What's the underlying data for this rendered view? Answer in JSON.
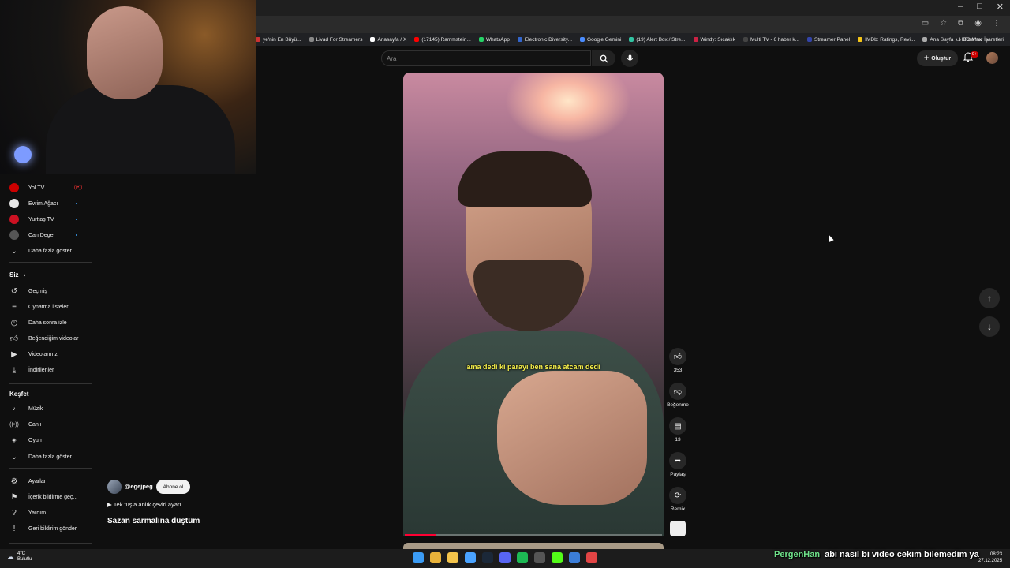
{
  "window": {
    "minimize": "–",
    "maximize": "□",
    "close": "✕"
  },
  "bookmarks": [
    {
      "label": "ye'nin En Büyü...",
      "color": "#cc3333"
    },
    {
      "label": "Livad For Streamers",
      "color": "#888888"
    },
    {
      "label": "Anasayfa / X",
      "color": "#ffffff"
    },
    {
      "label": "(17145) Rammstein...",
      "color": "#ff0000"
    },
    {
      "label": "WhatsApp",
      "color": "#25d366"
    },
    {
      "label": "Electronic Diversity...",
      "color": "#3366cc"
    },
    {
      "label": "Google Gemini",
      "color": "#4a8cff"
    },
    {
      "label": "(19) Alert Box / Stre...",
      "color": "#31c3a2"
    },
    {
      "label": "Windy: Sıcaklık",
      "color": "#cc2244"
    },
    {
      "label": "Multi TV - 6 haber k...",
      "color": "#444444"
    },
    {
      "label": "Streamer Panel",
      "color": "#3344aa"
    },
    {
      "label": "IMDb: Ratings, Revi...",
      "color": "#f5c518"
    },
    {
      "label": "Ana Sayfa + HBO Max",
      "color": "#aaaaaa"
    }
  ],
  "bookmarks_more": "»",
  "bookmarks_all": "Tüm Yer İşaretleri",
  "header": {
    "search_placeholder": "Ara",
    "create_label": "Oluştur",
    "notif_badge": "9+"
  },
  "sidebar": {
    "subscriptions": [
      {
        "label": "Yol TV",
        "icon_color": "#cc0000",
        "icon_text": "YOL",
        "status": "live"
      },
      {
        "label": "Evrim Ağacı",
        "icon_color": "#e8e8e8",
        "icon_text": "",
        "status": "new"
      },
      {
        "label": "Yurttaş TV",
        "icon_color": "#cc1122",
        "icon_text": "Y",
        "status": "new"
      },
      {
        "label": "Can Deger",
        "icon_color": "#555555",
        "icon_text": "",
        "status": "new"
      }
    ],
    "subs_more": "Daha fazla göster",
    "you_heading": "Siz",
    "you_items": [
      {
        "label": "Geçmiş",
        "icon": "↺"
      },
      {
        "label": "Oynatma listeleri",
        "icon": "≡"
      },
      {
        "label": "Daha sonra izle",
        "icon": "◷"
      },
      {
        "label": "Beğendiğim videolar",
        "icon": "👍"
      },
      {
        "label": "Videolarınız",
        "icon": "▶"
      },
      {
        "label": "İndirilenler",
        "icon": "⤓"
      }
    ],
    "explore_heading": "Keşfet",
    "explore_items": [
      {
        "label": "Müzik",
        "icon": "♪"
      },
      {
        "label": "Canlı",
        "icon": "((•))"
      },
      {
        "label": "Oyun",
        "icon": "🎮"
      }
    ],
    "explore_more": "Daha fazla göster",
    "settings_items": [
      {
        "label": "Ayarlar",
        "icon": "⚙"
      },
      {
        "label": "İçerik bildirme geç...",
        "icon": "⚑"
      },
      {
        "label": "Yardım",
        "icon": "?"
      },
      {
        "label": "Geri bildirim gönder",
        "icon": "!"
      }
    ]
  },
  "short": {
    "caption": "ama dedi ki parayı ben sana atcam dedi",
    "progress": 0.12,
    "channel": "@egejpeg",
    "subscribe": "Abone ol",
    "translate_line": "▶ Tek tuşla anlık çeviri ayarı",
    "title": "Sazan sarmalına düştüm",
    "actions": {
      "likes": "353",
      "dislike": "Beğenme",
      "comments": "13",
      "share": "Paylaş",
      "remix": "Remix"
    }
  },
  "nav": {
    "up": "↑",
    "down": "↓"
  },
  "taskbar": {
    "weather_temp": "4°C",
    "weather_desc": "Bulutlu",
    "apps": [
      "windows",
      "chrome",
      "explorer",
      "app4",
      "steam",
      "discord",
      "spotify",
      "calculator",
      "kick",
      "app10",
      "app11"
    ],
    "app_colors": [
      "#3b9cf5",
      "#e8b23a",
      "#f3c44b",
      "#4aa3ff",
      "#1b2838",
      "#5865f2",
      "#1db954",
      "#555555",
      "#53fc18",
      "#3b7dd8",
      "#e24444"
    ],
    "clock_time": "08:23",
    "clock_date": "27.12.2025"
  },
  "chat": {
    "user": "PergenHan",
    "message": "abi nasil bi video cekim bilemedim ya"
  }
}
